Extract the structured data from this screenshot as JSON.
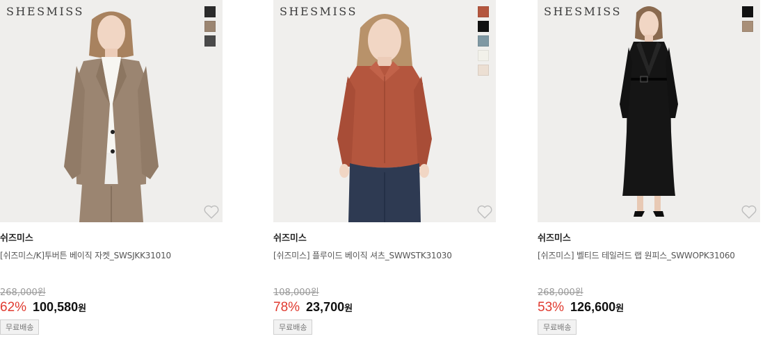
{
  "colors": {
    "discount": "#e03a2f",
    "background": "#f0efed"
  },
  "products": [
    {
      "logo": "SHESMISS",
      "swatches": [
        "#b4563e",
        "#111111",
        "#7f98a3",
        "#f2f1ea",
        "#ecdfd3"
      ],
      "favorite_icon": "heart-outline-icon",
      "brand": "쉬즈미스",
      "name": "[쉬즈미스] 플루이드 베이직 셔츠_SWWSTK31030",
      "original_price": "108,000원",
      "discount": "78%",
      "price": "23,700",
      "currency": "원",
      "badge": "무료배송"
    },
    {
      "logo": "SHESMISS",
      "swatches": [
        "#111111",
        "#a88f78"
      ],
      "favorite_icon": "heart-outline-icon",
      "brand": "쉬즈미스",
      "name": "[쉬즈미스] 벨티드 테일러드 랩 원피스_SWWOPK31060",
      "original_price": "268,000원",
      "discount": "53%",
      "price": "126,600",
      "currency": "원",
      "badge": "무료배송"
    },
    {
      "logo": "SHESMISS",
      "swatches": [
        "#2b2b2b",
        "#9b8571",
        "#4a4a4a"
      ],
      "favorite_icon": "heart-outline-icon",
      "brand": "쉬즈미스",
      "name": "[쉬즈미스/K]투버튼 베이직 자켓_SWSJKK31010",
      "original_price": "268,000원",
      "discount": "62%",
      "price": "100,580",
      "currency": "원",
      "badge": "무료배송"
    }
  ]
}
